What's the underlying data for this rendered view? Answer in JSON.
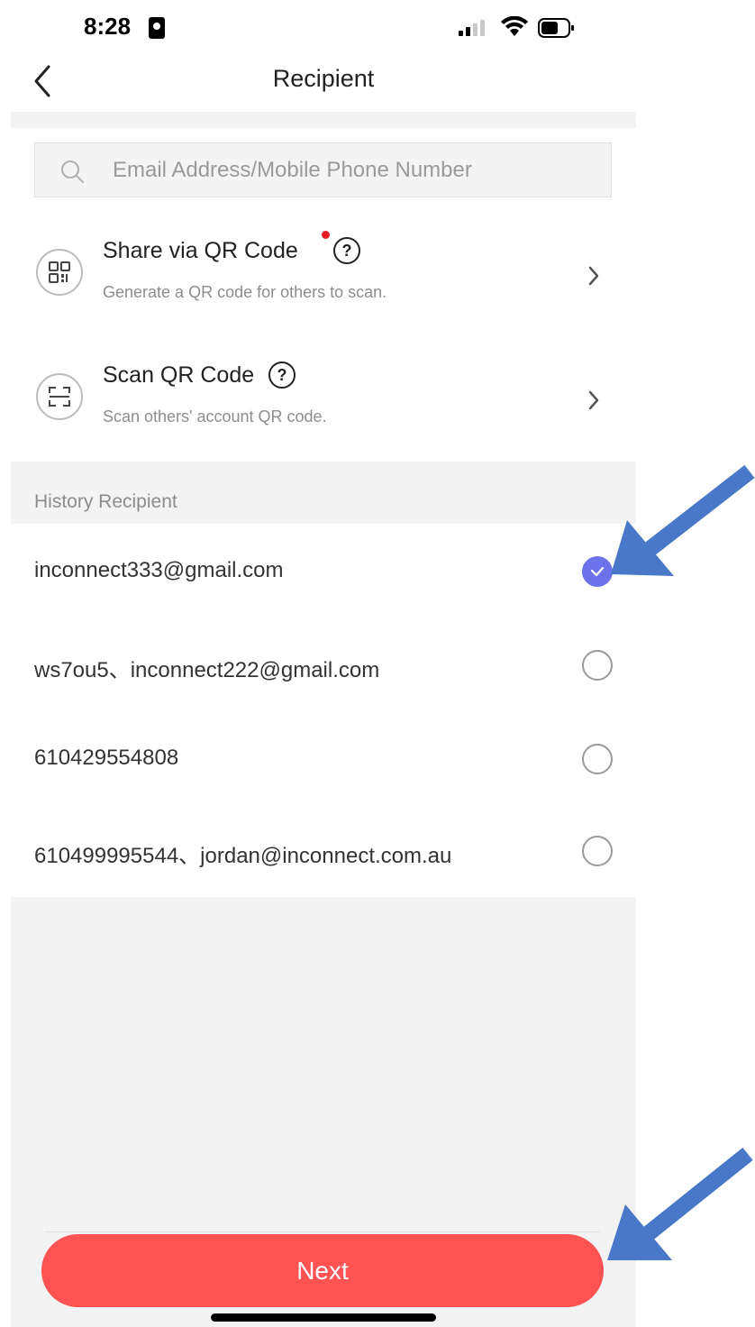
{
  "status_bar": {
    "time": "8:28"
  },
  "nav": {
    "title": "Recipient"
  },
  "search": {
    "placeholder": "Email Address/Mobile Phone Number",
    "value": ""
  },
  "options": [
    {
      "title": "Share via QR Code",
      "subtitle": "Generate a QR code for others to scan.",
      "help": "?",
      "icon": "qr-code-icon",
      "has_red_dot": true
    },
    {
      "title": "Scan QR Code",
      "subtitle": "Scan others' account QR code.",
      "help": "?",
      "icon": "scan-frame-icon",
      "has_red_dot": false
    }
  ],
  "history": {
    "label": "History Recipient",
    "items": [
      {
        "text": "inconnect333@gmail.com",
        "selected": true
      },
      {
        "text": "ws7ou5、inconnect222@gmail.com",
        "selected": false
      },
      {
        "text": "610429554808",
        "selected": false
      },
      {
        "text": "610499995544、jordan@inconnect.com.au",
        "selected": false
      }
    ]
  },
  "footer": {
    "next_label": "Next"
  },
  "colors": {
    "accent": "#ff5252",
    "selected": "#6b72ea",
    "annotation_arrow": "#4a78c8",
    "red_dot": "#e51c23"
  }
}
